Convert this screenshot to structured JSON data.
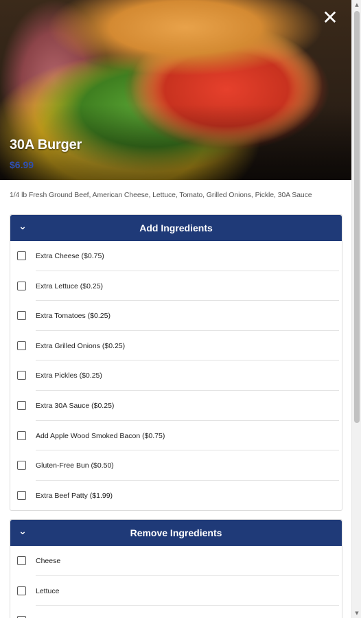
{
  "item": {
    "title": "30A Burger",
    "price": "$6.99",
    "description": "1/4 lb Fresh Ground Beef, American Cheese, Lettuce, Tomato, Grilled Onions, Pickle, 30A Sauce",
    "close_icon": "✕"
  },
  "add_section": {
    "title": "Add Ingredients",
    "chevron_icon": "chevron-down-icon",
    "options": [
      {
        "label": "Extra Cheese ($0.75)"
      },
      {
        "label": "Extra Lettuce ($0.25)"
      },
      {
        "label": "Extra Tomatoes ($0.25)"
      },
      {
        "label": "Extra Grilled Onions ($0.25)"
      },
      {
        "label": "Extra Pickles ($0.25)"
      },
      {
        "label": "Extra 30A Sauce ($0.25)"
      },
      {
        "label": "Add Apple Wood Smoked Bacon ($0.75)"
      },
      {
        "label": "Gluten-Free Bun ($0.50)"
      },
      {
        "label": "Extra Beef Patty ($1.99)"
      }
    ]
  },
  "remove_section": {
    "title": "Remove Ingredients",
    "chevron_icon": "chevron-down-icon",
    "options": [
      {
        "label": "Cheese"
      },
      {
        "label": "Lettuce"
      },
      {
        "label": ""
      }
    ]
  },
  "colors": {
    "header_blue": "#1f3a78",
    "price_blue": "#2f4fb0"
  }
}
